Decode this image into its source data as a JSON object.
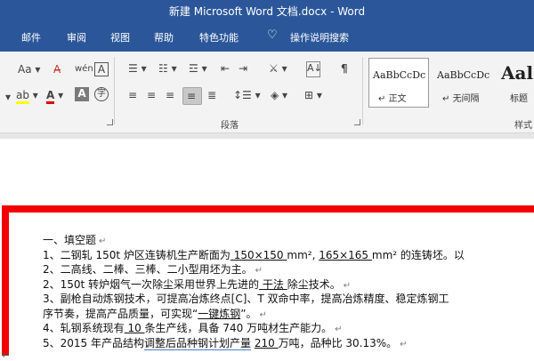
{
  "window": {
    "title": "新建 Microsoft Word 文档.docx - Word"
  },
  "menu": {
    "tabs": [
      "邮件",
      "审阅",
      "视图",
      "帮助",
      "特色功能"
    ],
    "tell_me": "操作说明搜索"
  },
  "ribbon": {
    "font_size_label": "Aa",
    "paragraph_group_label": "段落",
    "styles_group_label": "样式",
    "styles": [
      {
        "sample": "AaBbCcDc",
        "name": "正文"
      },
      {
        "sample": "AaBbCcDc",
        "name": "无间隔"
      },
      {
        "sample": "Aal",
        "name": "标题"
      }
    ]
  },
  "document": {
    "lines": [
      {
        "parts": [
          {
            "text": "一、填空题"
          }
        ],
        "mark": "↵"
      },
      {
        "parts": [
          {
            "text": "1、二钢轧 150t 炉区连铸机生产断面为"
          },
          {
            "text": "  150×150  ",
            "style": "u"
          },
          {
            "text": "mm², "
          },
          {
            "text": "  165×165  ",
            "style": "u"
          },
          {
            "text": "mm² 的连铸坯。以"
          }
        ],
        "mark": ""
      },
      {
        "parts": [
          {
            "text": "2、二高线、二棒、三棒、二小型用坯为主。"
          }
        ],
        "mark": "↵"
      },
      {
        "parts": [
          {
            "text": "2、150t 转炉烟气一次除尘采用世界上先进的"
          },
          {
            "text": "   干法   ",
            "style": "u"
          },
          {
            "text": "除尘技术。"
          }
        ],
        "mark": "↵"
      },
      {
        "parts": [
          {
            "text": "3、副枪自动炼钢技术，可提高冶炼终点[C]、T 双命中率，提高冶炼精度、稳定炼钢工"
          }
        ],
        "mark": ""
      },
      {
        "parts": [
          {
            "text": "序节奏，提高产品质量，可实现“"
          },
          {
            "text": "一键炼钢",
            "style": "u"
          },
          {
            "text": "”。"
          }
        ],
        "mark": "↵"
      },
      {
        "parts": [
          {
            "text": "4、轧钢系统现有"
          },
          {
            "text": "  10  ",
            "style": "u"
          },
          {
            "text": "条生产线，具备 740 万吨材生产能力。"
          }
        ],
        "mark": "↵"
      },
      {
        "parts": [
          {
            "text": "5、2015 年产品结构"
          },
          {
            "text": "调整后品种钢计划产量",
            "style": "blue"
          },
          {
            "text": "  "
          },
          {
            "text": "  210  ",
            "style": "u"
          },
          {
            "text": "  万吨，品种比 30.13%。"
          }
        ],
        "mark": "↵"
      }
    ],
    "trailing_mark": "↵"
  }
}
